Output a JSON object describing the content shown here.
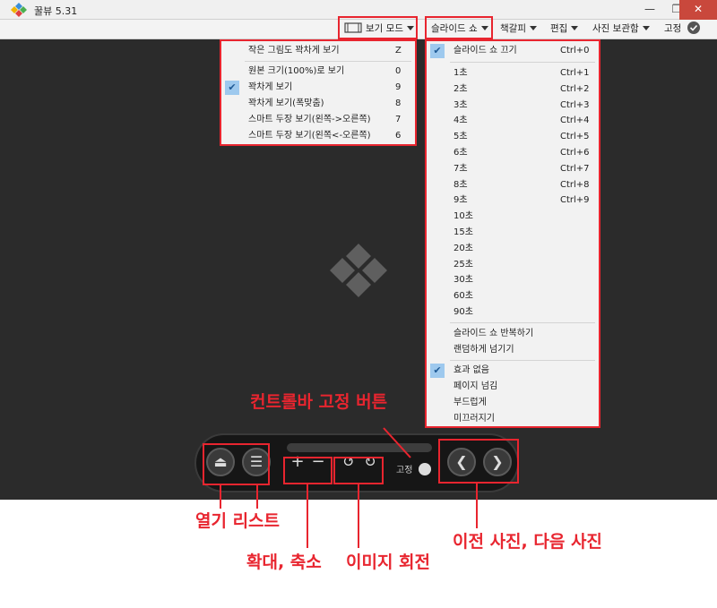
{
  "window": {
    "title": "꿀뷰 5.31",
    "minimize_glyph": "—",
    "restore_glyph": "❐",
    "close_glyph": "✕"
  },
  "menubar": {
    "view_mode": "보기 모드",
    "slideshow": "슬라이드 쇼",
    "bookmark": "책갈피",
    "edit": "편집",
    "photo_storage": "사진 보관함",
    "pin": "고정"
  },
  "view_mode_menu": {
    "items": [
      {
        "label": "작은 그림도 꽉차게 보기",
        "key": "Z",
        "checked": false
      },
      {
        "label": "원본 크기(100%)로 보기",
        "key": "0",
        "checked": false
      },
      {
        "label": "꽉차게 보기",
        "key": "9",
        "checked": true
      },
      {
        "label": "꽉차게 보기(폭맞춤)",
        "key": "8",
        "checked": false
      },
      {
        "label": "스마트 두장 보기(왼쪽->오른쪽)",
        "key": "7",
        "checked": false
      },
      {
        "label": "스마트 두장 보기(왼쪽<-오른쪽)",
        "key": "6",
        "checked": false
      }
    ]
  },
  "slideshow_menu": {
    "off": {
      "label": "슬라이드 쇼 끄기",
      "key": "Ctrl+0",
      "checked": true
    },
    "intervals": [
      {
        "label": "1초",
        "key": "Ctrl+1"
      },
      {
        "label": "2초",
        "key": "Ctrl+2"
      },
      {
        "label": "3초",
        "key": "Ctrl+3"
      },
      {
        "label": "4초",
        "key": "Ctrl+4"
      },
      {
        "label": "5초",
        "key": "Ctrl+5"
      },
      {
        "label": "6초",
        "key": "Ctrl+6"
      },
      {
        "label": "7초",
        "key": "Ctrl+7"
      },
      {
        "label": "8초",
        "key": "Ctrl+8"
      },
      {
        "label": "9초",
        "key": "Ctrl+9"
      },
      {
        "label": "10초",
        "key": ""
      },
      {
        "label": "15초",
        "key": ""
      },
      {
        "label": "20초",
        "key": ""
      },
      {
        "label": "25초",
        "key": ""
      },
      {
        "label": "30초",
        "key": ""
      },
      {
        "label": "60초",
        "key": ""
      },
      {
        "label": "90초",
        "key": ""
      }
    ],
    "repeat": "슬라이드 쇼 반복하기",
    "random": "랜덤하게 넘기기",
    "effects": [
      {
        "label": "효과 없음",
        "checked": true
      },
      {
        "label": "페이지 넘김",
        "checked": false
      },
      {
        "label": "부드럽게",
        "checked": false
      },
      {
        "label": "미끄러지기",
        "checked": false
      }
    ]
  },
  "controlbar": {
    "open_glyph": "⏏",
    "list_glyph": "☰",
    "zoom_in_glyph": "+",
    "zoom_out_glyph": "−",
    "rotate_left_glyph": "↺",
    "rotate_right_glyph": "↻",
    "pin_label": "고정",
    "prev_glyph": "❮",
    "next_glyph": "❯"
  },
  "annotations": {
    "pin_button": "컨트롤바 고정 버튼",
    "open_list": "열기 리스트",
    "zoom": "확대, 축소",
    "rotate": "이미지 회전",
    "prev_next": "이전 사진, 다음 사진"
  },
  "colors": {
    "annotation_red": "#e8252f",
    "viewer_bg": "#2b2b2b",
    "check_bg": "#9ec9ee"
  }
}
